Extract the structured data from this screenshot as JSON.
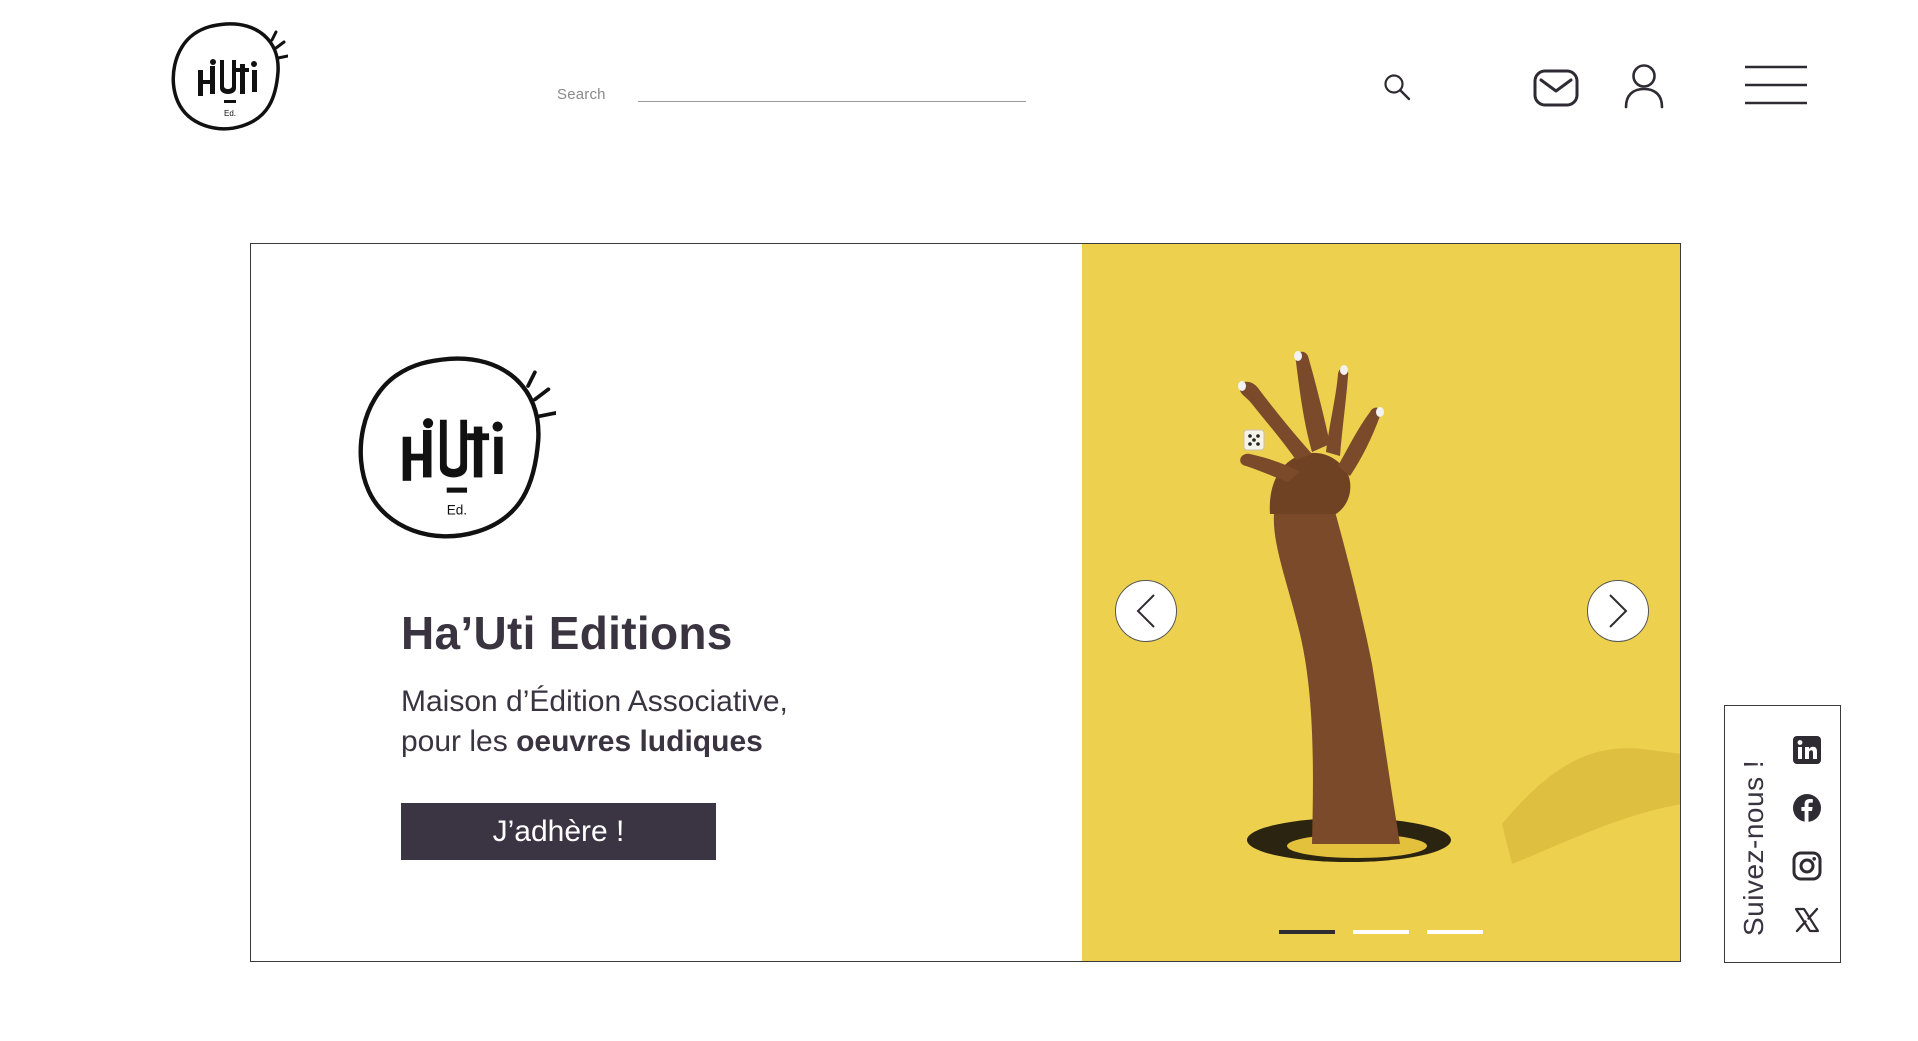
{
  "header": {
    "logo_alt": "Ha'Uti Ed.",
    "search": {
      "label": "Search",
      "placeholder": "",
      "value": ""
    },
    "icons": [
      "search-icon",
      "mail-icon",
      "user-icon",
      "hamburger-menu-icon"
    ]
  },
  "hero": {
    "title": "Ha’Uti Editions",
    "subtitle_line1": "Maison d’Édition Associative,",
    "subtitle_line2_prefix": "pour les ",
    "subtitle_line2_bold": "oeuvres ludiques",
    "cta_label": "J’adhère !",
    "slides": {
      "count": 3,
      "active_index": 0
    },
    "image": "hand-holding-die-from-hole-on-yellow-background",
    "colors": {
      "image_background": "#ecd04e",
      "cta_background": "#3b3543",
      "text": "#3a3340"
    }
  },
  "social": {
    "label": "Suivez-nous !",
    "icons": [
      "linkedin-icon",
      "facebook-icon",
      "instagram-icon",
      "x-icon"
    ]
  }
}
